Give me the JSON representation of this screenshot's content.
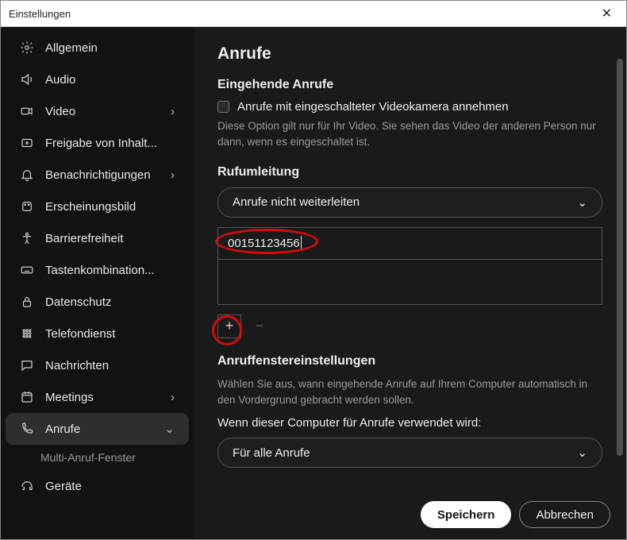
{
  "titlebar": {
    "title": "Einstellungen"
  },
  "sidebar": {
    "items": [
      {
        "label": "Allgemein",
        "icon": "gear-icon"
      },
      {
        "label": "Audio",
        "icon": "speaker-icon"
      },
      {
        "label": "Video",
        "icon": "video-icon",
        "expandable": true
      },
      {
        "label": "Freigabe von Inhalt...",
        "icon": "share-icon"
      },
      {
        "label": "Benachrichtigungen",
        "icon": "bell-icon",
        "expandable": true
      },
      {
        "label": "Erscheinungsbild",
        "icon": "palette-icon"
      },
      {
        "label": "Barrierefreiheit",
        "icon": "accessibility-icon"
      },
      {
        "label": "Tastenkombination...",
        "icon": "keyboard-icon"
      },
      {
        "label": "Datenschutz",
        "icon": "lock-icon"
      },
      {
        "label": "Telefondienst",
        "icon": "dialpad-icon"
      },
      {
        "label": "Nachrichten",
        "icon": "message-icon"
      },
      {
        "label": "Meetings",
        "icon": "calendar-icon",
        "expandable": true
      },
      {
        "label": "Anrufe",
        "icon": "phone-icon",
        "expandable": true,
        "active": true,
        "expanded": true
      },
      {
        "label": "Geräte",
        "icon": "headset-icon"
      }
    ],
    "sub_anrufe": "Multi-Anruf-Fenster"
  },
  "page": {
    "title": "Anrufe",
    "incoming_heading": "Eingehende Anrufe",
    "checkbox_label": "Anrufe mit eingeschalteter Videokamera annehmen",
    "checkbox_help": "Diese Option gilt nur für Ihr Video. Sie sehen das Video der anderen Person nur dann, wenn es eingeschaltet ist.",
    "forwarding_heading": "Rufumleitung",
    "forwarding_select": "Anrufe nicht weiterleiten",
    "phone_input": "00151123456",
    "add_symbol": "+",
    "remove_symbol": "−",
    "window_heading": "Anruffenstereinstellungen",
    "window_help": "Wählen Sie aus, wann eingehende Anrufe auf Ihrem Computer automatisch in den Vordergrund gebracht werden sollen.",
    "when_label": "Wenn dieser Computer für Anrufe verwendet wird:",
    "when_select": "Für alle Anrufe"
  },
  "footer": {
    "save": "Speichern",
    "cancel": "Abbrechen"
  },
  "annotations": {
    "phone_circle": true,
    "add_circle": true
  }
}
